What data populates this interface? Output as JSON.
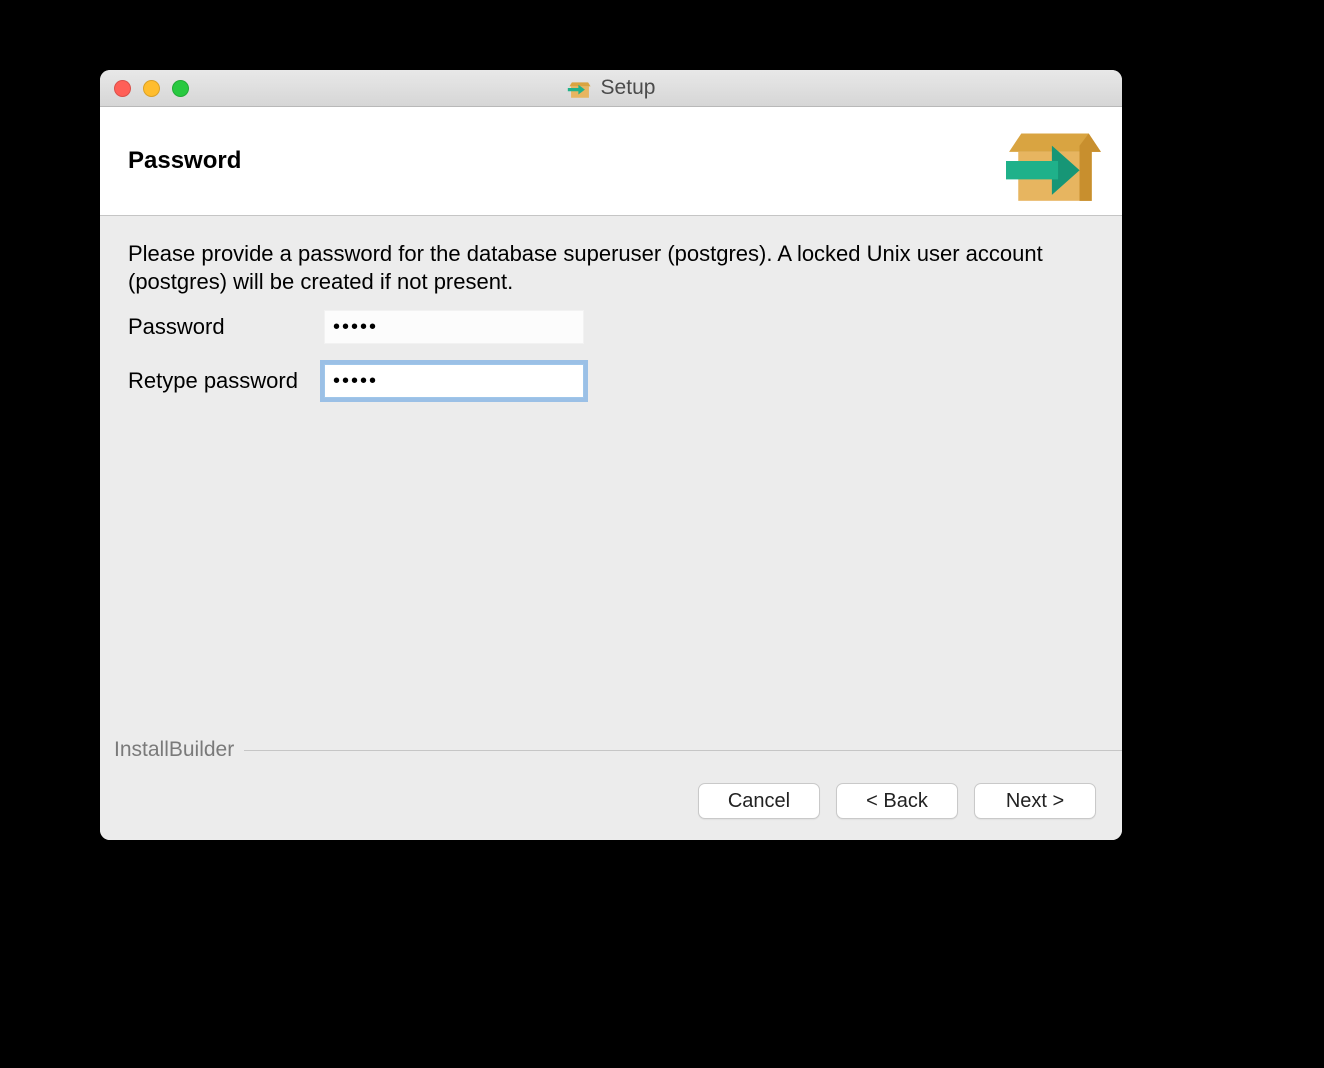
{
  "window": {
    "title": "Setup"
  },
  "header": {
    "title": "Password"
  },
  "content": {
    "description": "Please provide a password for the database superuser (postgres). A locked Unix user account (postgres) will be created if not present.",
    "password_label": "Password",
    "retype_label": "Retype password",
    "password_value": "•••••",
    "retype_value": "•••••"
  },
  "branding": "InstallBuilder",
  "buttons": {
    "cancel": "Cancel",
    "back": "< Back",
    "next": "Next >"
  }
}
